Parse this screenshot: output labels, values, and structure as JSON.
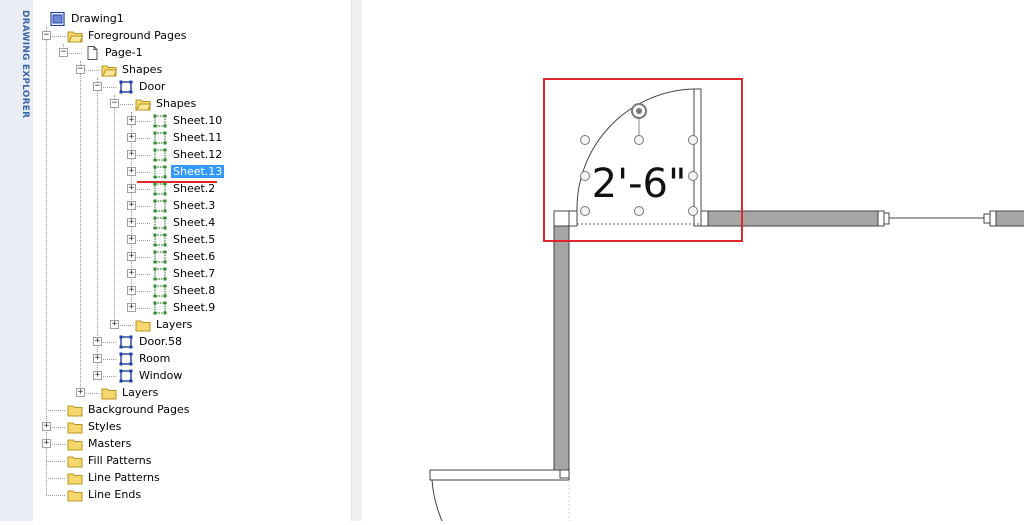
{
  "explorer": {
    "tab_label": "DRAWING EXPLORER",
    "tree": [
      {
        "label": "Drawing1",
        "level": 0,
        "icon": "drawing-icon",
        "expander": "none"
      },
      {
        "label": "Foreground Pages",
        "level": 1,
        "icon": "folder-open-icon",
        "expander": "minus"
      },
      {
        "label": "Page-1",
        "level": 2,
        "icon": "page-icon",
        "expander": "minus"
      },
      {
        "label": "Shapes",
        "level": 3,
        "icon": "folder-open-icon",
        "expander": "minus"
      },
      {
        "label": "Door",
        "level": 4,
        "icon": "group-shape-icon",
        "expander": "minus"
      },
      {
        "label": "Shapes",
        "level": 5,
        "icon": "folder-open-icon",
        "expander": "minus"
      },
      {
        "label": "Sheet.10",
        "level": 6,
        "icon": "shape-icon",
        "expander": "plus"
      },
      {
        "label": "Sheet.11",
        "level": 6,
        "icon": "shape-icon",
        "expander": "plus"
      },
      {
        "label": "Sheet.12",
        "level": 6,
        "icon": "shape-icon",
        "expander": "plus"
      },
      {
        "label": "Sheet.13",
        "level": 6,
        "icon": "shape-icon",
        "expander": "plus",
        "selected": true
      },
      {
        "label": "Sheet.2",
        "level": 6,
        "icon": "shape-icon",
        "expander": "plus"
      },
      {
        "label": "Sheet.3",
        "level": 6,
        "icon": "shape-icon",
        "expander": "plus"
      },
      {
        "label": "Sheet.4",
        "level": 6,
        "icon": "shape-icon",
        "expander": "plus"
      },
      {
        "label": "Sheet.5",
        "level": 6,
        "icon": "shape-icon",
        "expander": "plus"
      },
      {
        "label": "Sheet.6",
        "level": 6,
        "icon": "shape-icon",
        "expander": "plus"
      },
      {
        "label": "Sheet.7",
        "level": 6,
        "icon": "shape-icon",
        "expander": "plus"
      },
      {
        "label": "Sheet.8",
        "level": 6,
        "icon": "shape-icon",
        "expander": "plus"
      },
      {
        "label": "Sheet.9",
        "level": 6,
        "icon": "shape-icon",
        "expander": "plus"
      },
      {
        "label": "Layers",
        "level": 5,
        "icon": "folder-icon",
        "expander": "plus"
      },
      {
        "label": "Door.58",
        "level": 4,
        "icon": "group-shape-icon",
        "expander": "plus"
      },
      {
        "label": "Room",
        "level": 4,
        "icon": "group-shape-icon",
        "expander": "plus"
      },
      {
        "label": "Window",
        "level": 4,
        "icon": "group-shape-icon",
        "expander": "plus"
      },
      {
        "label": "Layers",
        "level": 3,
        "icon": "folder-icon",
        "expander": "plus"
      },
      {
        "label": "Background Pages",
        "level": 1,
        "icon": "folder-icon",
        "expander": "none"
      },
      {
        "label": "Styles",
        "level": 1,
        "icon": "folder-icon",
        "expander": "plus"
      },
      {
        "label": "Masters",
        "level": 1,
        "icon": "folder-icon",
        "expander": "plus"
      },
      {
        "label": "Fill Patterns",
        "level": 1,
        "icon": "folder-icon",
        "expander": "none"
      },
      {
        "label": "Line Patterns",
        "level": 1,
        "icon": "folder-icon",
        "expander": "none"
      },
      {
        "label": "Line Ends",
        "level": 1,
        "icon": "folder-icon",
        "expander": "none"
      }
    ]
  },
  "canvas": {
    "dimension_label": "2'-6\"",
    "highlight_color": "#e0262b",
    "wall_fill": "#a6a6a6"
  }
}
